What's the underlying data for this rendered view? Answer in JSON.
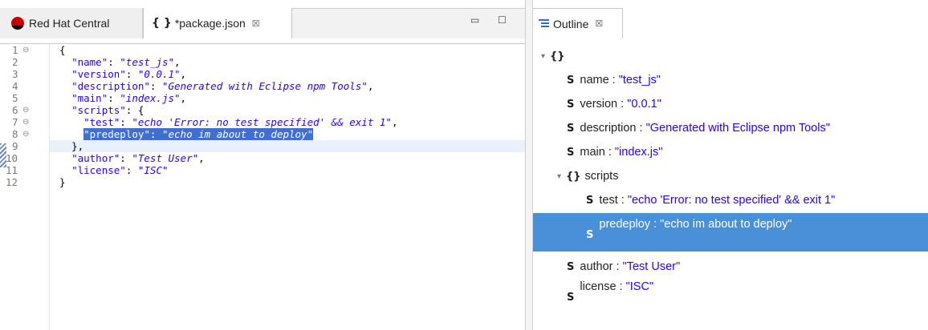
{
  "editor": {
    "tabs": [
      {
        "label": "Red Hat Central",
        "icon": "redhat-icon"
      },
      {
        "label": "*package.json",
        "icon": "json-braces-icon",
        "close": "☒"
      }
    ],
    "window_controls": {
      "minimize": "▭",
      "maximize": "☐"
    },
    "line_numbers": [
      "1",
      "2",
      "3",
      "4",
      "5",
      "6",
      "7",
      "8",
      "9",
      "10",
      "11",
      "12"
    ],
    "lines": [
      {
        "p1": "{"
      },
      {
        "key": "\"name\"",
        "sep": ": ",
        "value": "\"test_js\"",
        "tail": ","
      },
      {
        "key": "\"version\"",
        "sep": ": ",
        "value": "\"0.0.1\"",
        "tail": ","
      },
      {
        "key": "\"description\"",
        "sep": ": ",
        "value": "\"Generated with Eclipse npm Tools\"",
        "tail": ","
      },
      {
        "key": "\"main\"",
        "sep": ": ",
        "value": "\"index.js\"",
        "tail": ","
      },
      {
        "key": "\"scripts\"",
        "sep": ": ",
        "tail": "{"
      },
      {
        "key": "\"test\"",
        "sep": ": ",
        "value": "\"echo 'Error: no test specified' && exit 1\"",
        "tail": ","
      },
      {
        "key": "\"predeploy\"",
        "sep": ": ",
        "value": "\"echo im about to deploy\""
      },
      {
        "p1": "},"
      },
      {
        "key": "\"author\"",
        "sep": ": ",
        "value": "\"Test User\"",
        "tail": ","
      },
      {
        "key": "\"license\"",
        "sep": ": ",
        "value": "\"ISC\""
      },
      {
        "p1": "}"
      }
    ],
    "fold_marker": "⊖"
  },
  "outline": {
    "tab_label": "Outline",
    "tab_close": "☒",
    "root": {
      "twisty": "▾",
      "icon": "{}"
    },
    "items": [
      {
        "type": "S",
        "key": "name",
        "sep": " : ",
        "value": "\"test_js\""
      },
      {
        "type": "S",
        "key": "version",
        "sep": " : ",
        "value": "\"0.0.1\""
      },
      {
        "type": "S",
        "key": "description",
        "sep": " : ",
        "value": "\"Generated with Eclipse npm Tools\""
      },
      {
        "type": "S",
        "key": "main",
        "sep": " : ",
        "value": "\"index.js\""
      },
      {
        "type": "{}",
        "key": "scripts",
        "twisty": "▾"
      },
      {
        "type": "S",
        "key": "test",
        "sep": " : ",
        "value": "\"echo 'Error: no test specified' && exit 1\""
      },
      {
        "type": "S",
        "key": "predeploy",
        "sep": " : ",
        "value": "\"echo im about to deploy\""
      },
      {
        "type": "S",
        "key": "author",
        "sep": " : ",
        "value": "\"Test User\""
      },
      {
        "type": "S",
        "key": "license",
        "sep": " : ",
        "value": "\"ISC\""
      }
    ]
  },
  "colors": {
    "selection": "#3f6fd1",
    "outline_selection": "#4a90d9",
    "json_string": "#2a00ff"
  }
}
